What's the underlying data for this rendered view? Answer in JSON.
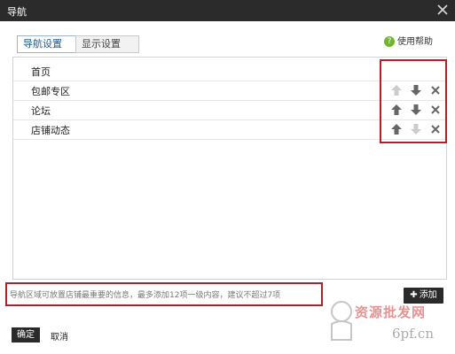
{
  "window": {
    "title": "导航"
  },
  "tabs": [
    {
      "label": "导航设置",
      "active": true
    },
    {
      "label": "显示设置",
      "active": false
    }
  ],
  "help": {
    "label": "使用帮助",
    "icon": "question-circle-icon",
    "icon_glyph": "?"
  },
  "nav_items": [
    {
      "label": "首页",
      "actions": []
    },
    {
      "label": "包邮专区",
      "actions": [
        "up-disabled",
        "down",
        "delete"
      ]
    },
    {
      "label": "论坛",
      "actions": [
        "up",
        "down",
        "delete"
      ]
    },
    {
      "label": "店铺动态",
      "actions": [
        "up",
        "down-disabled",
        "delete"
      ]
    }
  ],
  "hint": "导航区域可放置店铺最重要的信息，最多添加12项一级内容，建议不超过7项",
  "buttons": {
    "add_plus": "✚",
    "add": "添加",
    "ok": "确定",
    "cancel": "取消"
  },
  "watermark": {
    "text": "资源批发网",
    "url": "6pf.cn"
  },
  "colors": {
    "titlebar": "#2b2b2b",
    "annotation_red": "#b0202a",
    "help_green": "#6fb62a",
    "icon_active": "#666666",
    "icon_disabled": "#cccccc"
  }
}
